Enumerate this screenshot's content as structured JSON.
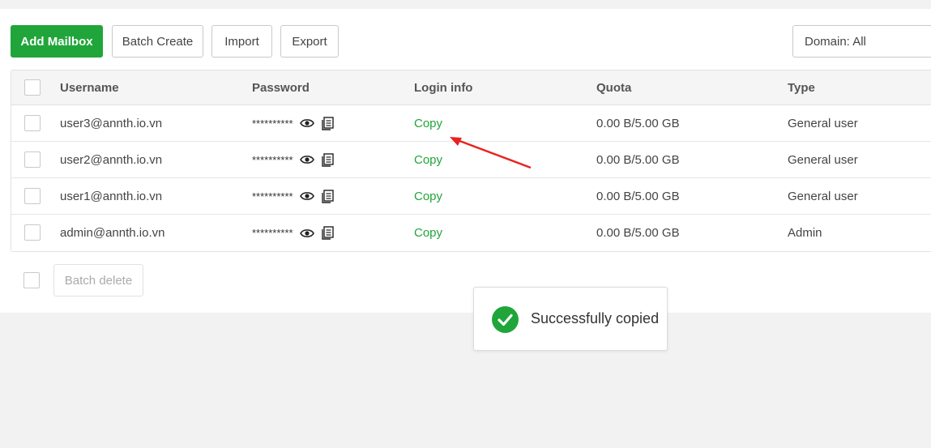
{
  "toolbar": {
    "add_mailbox": "Add Mailbox",
    "batch_create": "Batch Create",
    "import": "Import",
    "export": "Export",
    "domain_filter": "Domain: All"
  },
  "table": {
    "columns": {
      "username": "Username",
      "password": "Password",
      "login_info": "Login info",
      "quota": "Quota",
      "type": "Type"
    },
    "rows": [
      {
        "username": "user3@annth.io.vn",
        "password": "**********",
        "login_info": "Copy",
        "quota": "0.00 B/5.00 GB",
        "type": "General user"
      },
      {
        "username": "user2@annth.io.vn",
        "password": "**********",
        "login_info": "Copy",
        "quota": "0.00 B/5.00 GB",
        "type": "General user"
      },
      {
        "username": "user1@annth.io.vn",
        "password": "**********",
        "login_info": "Copy",
        "quota": "0.00 B/5.00 GB",
        "type": "General user"
      },
      {
        "username": "admin@annth.io.vn",
        "password": "**********",
        "login_info": "Copy",
        "quota": "0.00 B/5.00 GB",
        "type": "Admin"
      }
    ]
  },
  "footer": {
    "batch_delete": "Batch delete"
  },
  "toast": {
    "message": "Successfully copied",
    "icon": "check-circle-icon"
  },
  "colors": {
    "accent": "#20a53a",
    "annotation_arrow": "#e8231f"
  }
}
